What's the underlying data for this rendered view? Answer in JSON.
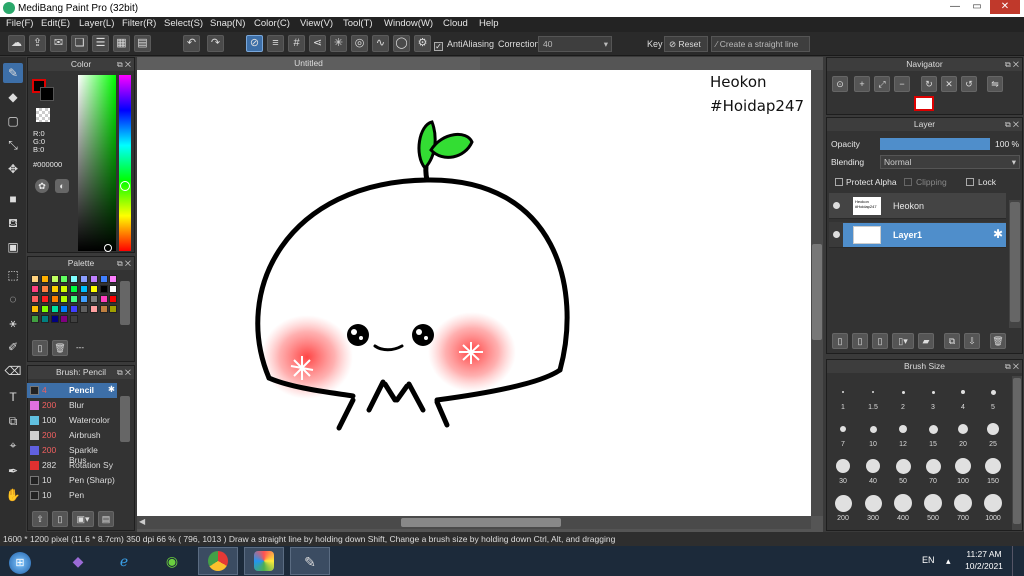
{
  "app": {
    "title": "MediBang Paint Pro (32bit)"
  },
  "menu": [
    "File(F)",
    "Edit(E)",
    "Layer(L)",
    "Filter(R)",
    "Select(S)",
    "Snap(N)",
    "Color(C)",
    "View(V)",
    "Tool(T)",
    "Window(W)",
    "Cloud",
    "Help"
  ],
  "toolbar": {
    "antialiasing_label": "AntiAliasing",
    "correction_label": "Correction",
    "correction_value": "40",
    "key_label": "Key",
    "reset_label": "Reset",
    "straight_line_label": "Create a straight line"
  },
  "color_panel": {
    "title": "Color",
    "r": "R:0",
    "g": "G:0",
    "b": "B:0",
    "hex": "#000000"
  },
  "palette_panel": {
    "title": "Palette",
    "status": "---",
    "colors": [
      "#ffd27f",
      "#ffb000",
      "#c0ff60",
      "#60ff60",
      "#7fffff",
      "#8a9eff",
      "#c080ff",
      "#3f7fff",
      "#ff80ff",
      "#ff4080",
      "#ff8040",
      "#ffd000",
      "#d0ff00",
      "#00ff40",
      "#00c0ff",
      "#ffff00",
      "#000000",
      "#ffffff",
      "#ff6060",
      "#ff2020",
      "#ff8000",
      "#b0ff00",
      "#40ff80",
      "#40a0ff",
      "#808080",
      "#ff40c0",
      "#ff0000",
      "#ffc000",
      "#80ff00",
      "#00e0a0",
      "#0080ff",
      "#4040ff",
      "#606060",
      "#ffa0a0",
      "#c08040",
      "#a0a000",
      "#40a040",
      "#008080",
      "#000080",
      "#800080",
      "#404040"
    ]
  },
  "brush_panel": {
    "title": "Brush: Pencil",
    "brushes": [
      {
        "size": "4",
        "name": "Pencil",
        "color": "#222222"
      },
      {
        "size": "200",
        "name": "Blur",
        "color": "#e070e0"
      },
      {
        "size": "100",
        "name": "Watercolor",
        "color": "#60c0e0"
      },
      {
        "size": "200",
        "name": "Airbrush",
        "color": "#d0d0d0"
      },
      {
        "size": "200",
        "name": "Sparkle Brus",
        "color": "#6060e0"
      },
      {
        "size": "282",
        "name": "Rotation Sy",
        "color": "#e03030"
      },
      {
        "size": "10",
        "name": "Pen (Sharp)",
        "color": "#222222"
      },
      {
        "size": "10",
        "name": "Pen",
        "color": "#222222"
      }
    ]
  },
  "document": {
    "tab": "Untitled",
    "watermark_line1": "Heokon",
    "watermark_line2": "#Hoidap247"
  },
  "navigator": {
    "title": "Navigator"
  },
  "layer_panel": {
    "title": "Layer",
    "opacity_label": "Opacity",
    "opacity_value": "100 %",
    "opacity_fraction": 1.0,
    "blending_label": "Blending",
    "blending_value": "Normal",
    "protect_alpha": "Protect Alpha",
    "clipping": "Clipping",
    "lock": "Lock",
    "layers": [
      {
        "name": "Heokon",
        "thumb_text": "Heokon #Hoidap247"
      },
      {
        "name": "Layer1"
      }
    ]
  },
  "brush_size_panel": {
    "title": "Brush Size",
    "sizes": [
      "1",
      "1.5",
      "2",
      "3",
      "4",
      "5",
      "7",
      "10",
      "12",
      "15",
      "20",
      "25",
      "30",
      "40",
      "50",
      "70",
      "100",
      "150",
      "200",
      "300",
      "400",
      "500",
      "700",
      "1000"
    ]
  },
  "status": {
    "size": "1600 * 1200 pixel",
    "cm": "(11.6 * 8.7cm)",
    "dpi": "350 dpi",
    "zoom": "66 %",
    "coords": "( 796, 1013 )",
    "hint": "Draw a straight line by holding down Shift, Change a brush size by holding down Ctrl, Alt, and dragging"
  },
  "taskbar": {
    "lang": "EN",
    "time": "11:27 AM",
    "date": "10/2/2021"
  }
}
